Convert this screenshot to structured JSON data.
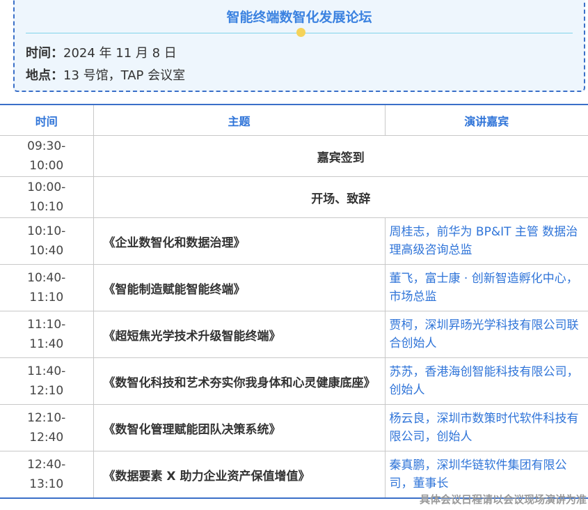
{
  "forum": {
    "title": "智能终端数智化发展论坛",
    "time_label": "时间：",
    "time_value": "2024 年 11 月 8 日",
    "place_label": "地点：",
    "place_value": "13 号馆，TAP 会议室"
  },
  "table": {
    "headers": [
      "时间",
      "主题",
      "演讲嘉宾"
    ],
    "rows": [
      {
        "time": "09:30-\n10:00",
        "topic": "嘉宾签到",
        "speaker": ""
      },
      {
        "time": "10:00-\n10:10",
        "topic": "开场、致辞",
        "speaker": ""
      },
      {
        "time": "10:10-\n10:40",
        "topic": "《企业数智化和数据治理》",
        "speaker": "周桂志，前华为 BP&IT 主管 数据治理高级咨询总监"
      },
      {
        "time": "10:40-\n11:10",
        "topic": "《智能制造赋能智能终端》",
        "speaker": "董飞，富士康 · 创新智造孵化中心，市场总监"
      },
      {
        "time": "11:10-\n11:40",
        "topic": "《超短焦光学技术升级智能终端》",
        "speaker": "贾柯，深圳昇旸光学科技有限公司联合创始人"
      },
      {
        "time": "11:40-\n12:10",
        "topic": "《数智化科技和艺术夯实你我身体和心灵健康底座》",
        "speaker": "苏苏，香港海创智能科技有限公司，创始人"
      },
      {
        "time": "12:10-\n12:40",
        "topic": "《数智化管理赋能团队决策系统》",
        "speaker": "杨云良，深圳市数策时代软件科技有限公司，创始人"
      },
      {
        "time": "12:40-\n13:10",
        "topic": "《数据要素 X 助力企业资产保值增值》",
        "speaker": "秦真鹏，深圳华链软件集团有限公司，董事长"
      }
    ]
  },
  "footnote": "具体会议日程请以会议现场演讲为准"
}
